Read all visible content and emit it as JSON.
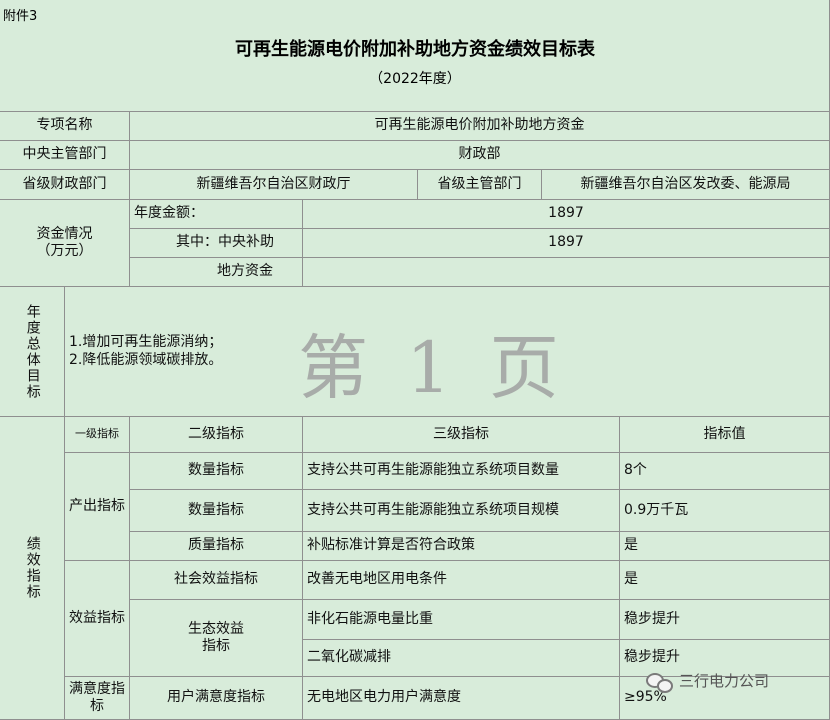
{
  "header": {
    "attachment": "附件3",
    "title": "可再生能源电价附加补助地方资金绩效目标表",
    "year": "（2022年度）"
  },
  "project": {
    "name_label": "专项名称",
    "name_value": "可再生能源电价附加补助地方资金",
    "dept_label": "中央主管部门",
    "dept_value": "财政部",
    "finance_label": "省级财政部门",
    "finance_value": "新疆维吾尔自治区财政厅",
    "provincial_label": "省级主管部门",
    "provincial_value": "新疆维吾尔自治区发改委、能源局"
  },
  "funds": {
    "label": "资金情况\n（万元）",
    "annual_label": "年度金额：",
    "annual_value": "1897",
    "central_label": "其中：中央补助",
    "central_value": "1897",
    "local_label": "地方资金",
    "local_value": ""
  },
  "goals": {
    "label": "年度总体目标",
    "text": "1.增加可再生能源消纳；\n2.降低能源领域碳排放。"
  },
  "performance": {
    "label": "绩效指标",
    "headers": [
      "一级指标",
      "二级指标",
      "三级指标",
      "指标值"
    ],
    "output_label": "产出指标",
    "benefit_label": "效益指标",
    "satisfaction_label": "满意度指标",
    "rows": [
      {
        "second": "数量指标",
        "third": "支持公共可再生能源能独立系统项目数量",
        "value": "8个"
      },
      {
        "second": "数量指标",
        "third": "支持公共可再生能源能独立系统项目规模",
        "value": "0.9万千瓦"
      },
      {
        "second": "质量指标",
        "third": "补贴标准计算是否符合政策",
        "value": "是"
      },
      {
        "second": "社会效益指标",
        "third": "改善无电地区用电条件",
        "value": "是"
      },
      {
        "second": "生态效益\n指标",
        "third": "非化石能源电量比重",
        "value": "稳步提升"
      },
      {
        "third": "二氧化碳减排",
        "value": "稳步提升"
      },
      {
        "second": "用户满意度指标",
        "third": "无电地区电力用户满意度",
        "value": "≥95%"
      }
    ]
  },
  "watermark": "第 1 页",
  "brand": "三行电力公司",
  "brand_icon": "wechat-icon"
}
